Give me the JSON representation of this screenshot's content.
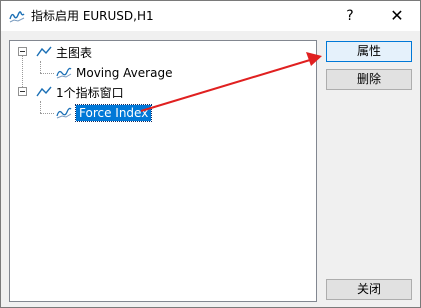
{
  "window": {
    "title": "指标启用 EURUSD,H1",
    "help_label": "?",
    "close_label": "✕"
  },
  "tree": {
    "nodes": [
      {
        "label": "主图表",
        "children": [
          {
            "label": "Moving Average"
          }
        ]
      },
      {
        "label": "1个指标窗口",
        "children": [
          {
            "label": "Force Index",
            "selected": true
          }
        ]
      }
    ]
  },
  "buttons": {
    "properties": "属性",
    "delete": "删除",
    "close": "关闭"
  },
  "colors": {
    "selection": "#0078d7",
    "annotation_arrow": "#e02020",
    "icon_line": "#1a6fb5"
  }
}
